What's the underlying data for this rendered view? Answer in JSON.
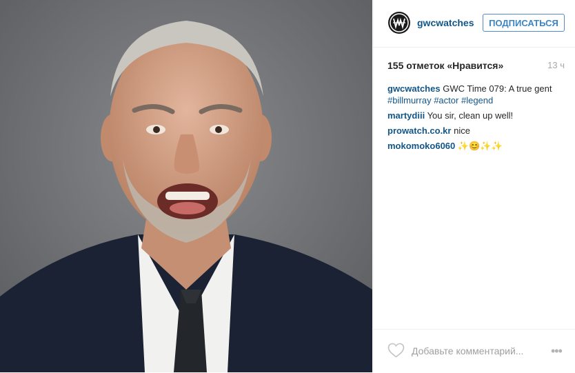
{
  "post": {
    "username": "gwcwatches",
    "follow_label": "ПОДПИСАТЬСЯ",
    "likes_text": "155 отметок «Нравится»",
    "time_text": "13 ч",
    "caption": {
      "username": "gwcwatches",
      "text": "GWC Time 079: A true gent",
      "hashtags": [
        "#billmurray",
        "#actor",
        "#legend"
      ]
    },
    "comments": [
      {
        "username": "martydiii",
        "text": "You sir, clean up well!"
      },
      {
        "username": "prowatch.co.kr",
        "text": "nice"
      },
      {
        "username": "mokomoko6060",
        "text": "✨😊✨✨"
      }
    ],
    "add_comment_placeholder": "Добавьте комментарий...",
    "more_icon": "•••"
  },
  "icons": {
    "avatar": "gwc-logo-icon",
    "heart": "heart-outline-icon",
    "more": "more-dots-icon"
  },
  "colors": {
    "link": "#125688",
    "follow_blue": "#3b85c3",
    "muted": "#a5a7aa",
    "photo_bg": "#6f7073"
  }
}
